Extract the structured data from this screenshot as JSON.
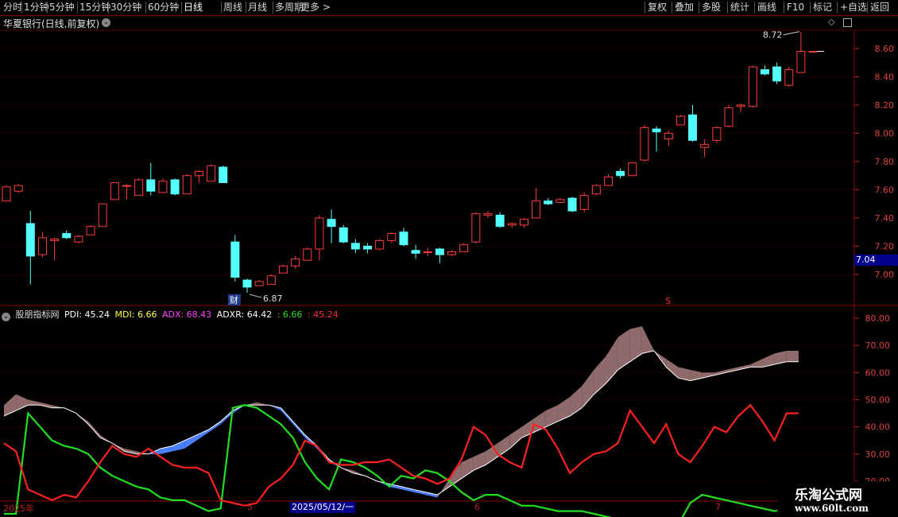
{
  "toolbar": {
    "periods": [
      "分时",
      "1分钟",
      "5分钟",
      "15分钟",
      "30分钟",
      "60分钟",
      "日线",
      "周线",
      "月线",
      "多周期",
      "更多 >"
    ],
    "active_period": "日线",
    "right_buttons": [
      "复权",
      "叠加",
      "多股",
      "统计",
      "画线",
      "F10",
      "标记",
      "+自选",
      "返回"
    ]
  },
  "title": {
    "stock": "华夏银行(日线,前复权)"
  },
  "price_axis": {
    "ticks": [
      "8.60",
      "8.40",
      "8.20",
      "8.00",
      "7.80",
      "7.60",
      "7.40",
      "7.20",
      "7.00"
    ],
    "current_price": "7.04"
  },
  "annotations": {
    "high": "8.72",
    "low": "6.87",
    "cai_label": "财",
    "s_marker": "S"
  },
  "indicator": {
    "name": "股朋指标网",
    "pdi_label": "PDI: 45.24",
    "mdi_label": "MDI: 6.66",
    "adx_label": "ADX: 68.43",
    "adxr_label": "ADXR: 64.42",
    "extra1": ": 6.66",
    "extra2": ": 45.24",
    "axis_ticks": [
      "80.00",
      "70.00",
      "60.00",
      "50.00",
      "40.00",
      "30.00",
      "20.00"
    ],
    "colors": {
      "pdi": "#ff2020",
      "mdi": "#20e020",
      "adx": "#ff40ff",
      "adxr": "#ffffff",
      "up_fill": "#8f6a6a",
      "down_fill": "#4a7fff"
    }
  },
  "dates": {
    "start": "2025年",
    "m5": "5",
    "current": "2025/05/12/一",
    "m6": "6",
    "m7": "7"
  },
  "watermark": {
    "line1": "乐淘公式网",
    "line2": "www.60lt.com"
  },
  "chart_data": {
    "type": "candlestick",
    "ylim": [
      6.8,
      8.8
    ],
    "candles": [
      {
        "o": 7.52,
        "h": 7.63,
        "l": 7.52,
        "c": 7.62
      },
      {
        "o": 7.59,
        "h": 7.64,
        "l": 7.58,
        "c": 7.63
      },
      {
        "o": 7.36,
        "h": 7.45,
        "l": 6.93,
        "c": 7.13
      },
      {
        "o": 7.14,
        "h": 7.3,
        "l": 7.12,
        "c": 7.26
      },
      {
        "o": 7.24,
        "h": 7.26,
        "l": 7.1,
        "c": 7.25
      },
      {
        "o": 7.29,
        "h": 7.31,
        "l": 7.25,
        "c": 7.26
      },
      {
        "o": 7.23,
        "h": 7.28,
        "l": 7.22,
        "c": 7.27
      },
      {
        "o": 7.28,
        "h": 7.35,
        "l": 7.28,
        "c": 7.34
      },
      {
        "o": 7.34,
        "h": 7.5,
        "l": 7.34,
        "c": 7.5
      },
      {
        "o": 7.53,
        "h": 7.65,
        "l": 7.53,
        "c": 7.65
      },
      {
        "o": 7.63,
        "h": 7.64,
        "l": 7.53,
        "c": 7.63
      },
      {
        "o": 7.56,
        "h": 7.68,
        "l": 7.56,
        "c": 7.67
      },
      {
        "o": 7.67,
        "h": 7.79,
        "l": 7.56,
        "c": 7.59
      },
      {
        "o": 7.58,
        "h": 7.68,
        "l": 7.58,
        "c": 7.66
      },
      {
        "o": 7.67,
        "h": 7.68,
        "l": 7.56,
        "c": 7.57
      },
      {
        "o": 7.57,
        "h": 7.71,
        "l": 7.57,
        "c": 7.7
      },
      {
        "o": 7.7,
        "h": 7.74,
        "l": 7.65,
        "c": 7.73
      },
      {
        "o": 7.66,
        "h": 7.78,
        "l": 7.66,
        "c": 7.77
      },
      {
        "o": 7.76,
        "h": 7.77,
        "l": 7.65,
        "c": 7.65
      },
      {
        "o": 7.23,
        "h": 7.28,
        "l": 6.95,
        "c": 6.98
      },
      {
        "o": 6.96,
        "h": 6.97,
        "l": 6.87,
        "c": 6.91
      },
      {
        "o": 6.92,
        "h": 6.96,
        "l": 6.92,
        "c": 6.95
      },
      {
        "o": 6.93,
        "h": 7.0,
        "l": 6.93,
        "c": 6.99
      },
      {
        "o": 7.01,
        "h": 7.07,
        "l": 7.01,
        "c": 7.06
      },
      {
        "o": 7.06,
        "h": 7.13,
        "l": 7.04,
        "c": 7.11
      },
      {
        "o": 7.1,
        "h": 7.19,
        "l": 7.1,
        "c": 7.18
      },
      {
        "o": 7.18,
        "h": 7.42,
        "l": 7.1,
        "c": 7.4
      },
      {
        "o": 7.39,
        "h": 7.46,
        "l": 7.22,
        "c": 7.34
      },
      {
        "o": 7.33,
        "h": 7.35,
        "l": 7.22,
        "c": 7.23
      },
      {
        "o": 7.22,
        "h": 7.25,
        "l": 7.15,
        "c": 7.18
      },
      {
        "o": 7.2,
        "h": 7.22,
        "l": 7.15,
        "c": 7.18
      },
      {
        "o": 7.18,
        "h": 7.25,
        "l": 7.17,
        "c": 7.24
      },
      {
        "o": 7.24,
        "h": 7.3,
        "l": 7.22,
        "c": 7.29
      },
      {
        "o": 7.3,
        "h": 7.33,
        "l": 7.2,
        "c": 7.21
      },
      {
        "o": 7.17,
        "h": 7.21,
        "l": 7.11,
        "c": 7.15
      },
      {
        "o": 7.16,
        "h": 7.19,
        "l": 7.13,
        "c": 7.16
      },
      {
        "o": 7.18,
        "h": 7.19,
        "l": 7.08,
        "c": 7.14
      },
      {
        "o": 7.14,
        "h": 7.17,
        "l": 7.13,
        "c": 7.16
      },
      {
        "o": 7.16,
        "h": 7.22,
        "l": 7.16,
        "c": 7.21
      },
      {
        "o": 7.23,
        "h": 7.44,
        "l": 7.22,
        "c": 7.43
      },
      {
        "o": 7.42,
        "h": 7.45,
        "l": 7.4,
        "c": 7.43
      },
      {
        "o": 7.42,
        "h": 7.44,
        "l": 7.33,
        "c": 7.34
      },
      {
        "o": 7.35,
        "h": 7.37,
        "l": 7.33,
        "c": 7.36
      },
      {
        "o": 7.35,
        "h": 7.4,
        "l": 7.33,
        "c": 7.39
      },
      {
        "o": 7.4,
        "h": 7.61,
        "l": 7.4,
        "c": 7.52
      },
      {
        "o": 7.52,
        "h": 7.54,
        "l": 7.49,
        "c": 7.5
      },
      {
        "o": 7.51,
        "h": 7.54,
        "l": 7.51,
        "c": 7.53
      },
      {
        "o": 7.54,
        "h": 7.55,
        "l": 7.44,
        "c": 7.45
      },
      {
        "o": 7.46,
        "h": 7.58,
        "l": 7.44,
        "c": 7.56
      },
      {
        "o": 7.57,
        "h": 7.64,
        "l": 7.56,
        "c": 7.63
      },
      {
        "o": 7.63,
        "h": 7.71,
        "l": 7.63,
        "c": 7.69
      },
      {
        "o": 7.73,
        "h": 7.75,
        "l": 7.68,
        "c": 7.7
      },
      {
        "o": 7.7,
        "h": 7.79,
        "l": 7.7,
        "c": 7.79
      },
      {
        "o": 7.81,
        "h": 8.06,
        "l": 7.8,
        "c": 8.04
      },
      {
        "o": 8.03,
        "h": 8.05,
        "l": 7.87,
        "c": 8.01
      },
      {
        "o": 7.96,
        "h": 8.02,
        "l": 7.91,
        "c": 8.0
      },
      {
        "o": 8.06,
        "h": 8.13,
        "l": 8.06,
        "c": 8.12
      },
      {
        "o": 8.13,
        "h": 8.2,
        "l": 7.94,
        "c": 7.95
      },
      {
        "o": 7.9,
        "h": 7.96,
        "l": 7.83,
        "c": 7.92
      },
      {
        "o": 7.95,
        "h": 8.05,
        "l": 7.93,
        "c": 8.04
      },
      {
        "o": 8.05,
        "h": 8.2,
        "l": 8.04,
        "c": 8.18
      },
      {
        "o": 8.19,
        "h": 8.21,
        "l": 8.15,
        "c": 8.2
      },
      {
        "o": 8.19,
        "h": 8.48,
        "l": 8.18,
        "c": 8.47
      },
      {
        "o": 8.45,
        "h": 8.48,
        "l": 8.41,
        "c": 8.42
      },
      {
        "o": 8.47,
        "h": 8.5,
        "l": 8.35,
        "c": 8.37
      },
      {
        "o": 8.34,
        "h": 8.47,
        "l": 8.33,
        "c": 8.45
      },
      {
        "o": 8.43,
        "h": 8.72,
        "l": 8.43,
        "c": 8.58
      },
      {
        "o": 8.58,
        "h": 8.58,
        "l": 8.58,
        "c": 8.58
      }
    ],
    "dmi": {
      "pdi": [
        34,
        31,
        17,
        15,
        13,
        15,
        14,
        20,
        27,
        33,
        30,
        29,
        32,
        29,
        26,
        25,
        25,
        23,
        13,
        12,
        11,
        12,
        18,
        21,
        26,
        35,
        33,
        27,
        26,
        26,
        27,
        27,
        28,
        25,
        22,
        21,
        19,
        21,
        28,
        40,
        37,
        30,
        27,
        25,
        41,
        39,
        32,
        23,
        27,
        30,
        31,
        34,
        46,
        40,
        34,
        41,
        30,
        27,
        33,
        40,
        38,
        44,
        48,
        42,
        35,
        45,
        45
      ],
      "mdi": [
        8,
        8,
        45,
        40,
        35,
        33,
        32,
        30,
        25,
        22,
        20,
        18,
        17,
        14,
        13,
        13,
        11,
        9,
        10,
        47,
        48,
        47,
        44,
        41,
        36,
        27,
        21,
        17,
        28,
        27,
        25,
        22,
        18,
        22,
        21,
        24,
        23,
        20,
        16,
        13,
        15,
        15,
        13,
        11,
        11,
        10,
        9,
        9,
        9,
        8,
        7,
        6,
        6,
        5,
        4,
        4,
        4,
        12,
        15,
        14,
        13,
        12,
        11,
        10,
        9,
        10,
        11
      ],
      "adx": [
        48,
        52,
        50,
        49,
        48,
        47,
        45,
        42,
        37,
        34,
        32,
        31,
        30,
        30,
        31,
        32,
        35,
        38,
        41,
        45,
        48,
        49,
        48,
        46,
        41,
        36,
        32,
        27,
        25,
        24,
        22,
        20,
        18,
        17,
        16,
        15,
        14,
        21,
        27,
        29,
        31,
        34,
        37,
        40,
        43,
        46,
        48,
        51,
        55,
        61,
        66,
        73,
        76,
        77,
        68,
        65,
        62,
        61,
        60,
        60,
        61,
        62,
        63,
        65,
        67,
        68,
        68
      ],
      "adxr": [
        44,
        46,
        48,
        48,
        47,
        47,
        45,
        41,
        36,
        34,
        31,
        30,
        30,
        32,
        33,
        35,
        37,
        39,
        42,
        46,
        48,
        48,
        48,
        47,
        42,
        37,
        33,
        28,
        25,
        23,
        22,
        20,
        19,
        18,
        17,
        16,
        15,
        18,
        21,
        24,
        26,
        29,
        32,
        36,
        38,
        40,
        42,
        44,
        47,
        52,
        56,
        61,
        64,
        67,
        68,
        62,
        58,
        57,
        58,
        59,
        60,
        61,
        62,
        62,
        63,
        64,
        64
      ]
    }
  }
}
